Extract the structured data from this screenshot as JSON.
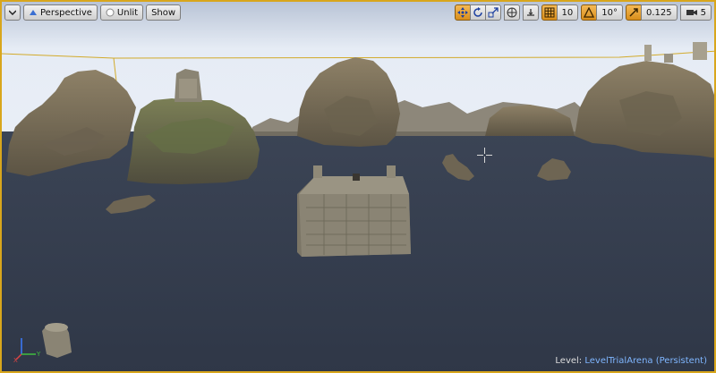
{
  "toolbar": {
    "menu_icon": "chevron-down-icon",
    "perspective_label": "Perspective",
    "unlit_label": "Unlit",
    "show_label": "Show",
    "grid_snap_value": "10",
    "rotation_snap_value": "10°",
    "scale_snap_value": "0.125",
    "camera_speed_value": "5"
  },
  "status": {
    "level_prefix": "Level:",
    "level_name": "LevelTrialArena (Persistent)"
  },
  "colors": {
    "selection_border": "#d8a61c",
    "active_button": "#e7a33a",
    "water": "#353d4e",
    "sky": "#dfe8f4",
    "level_name": "#7fb6ff"
  }
}
